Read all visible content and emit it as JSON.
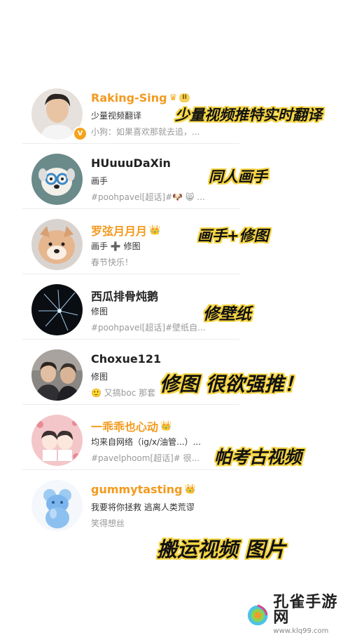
{
  "users": [
    {
      "name": "Raking-Sing",
      "name_style": "orange",
      "crown": "♛",
      "level": "II",
      "verified": "V",
      "line2": "少量视频翻译",
      "line3": "小狗：如果喜欢那就去追，..."
    },
    {
      "name": "HUuuuDaXin",
      "name_style": "dark",
      "crown": "",
      "level": "",
      "verified": "",
      "line2": "画手",
      "line3": "#poohpavel[超话]#🐶 😸 ..."
    },
    {
      "name": "罗弦月月月",
      "name_style": "orange",
      "crown": "👑",
      "level": "",
      "verified": "",
      "line2": "画手 ➕ 修图",
      "line3": "春节快乐！"
    },
    {
      "name": "西瓜排骨炖鹅",
      "name_style": "dark",
      "crown": "",
      "level": "",
      "verified": "",
      "line2": "修图",
      "line3": "#poohpavel[超话]#壁纸自..."
    },
    {
      "name": "Choxue121",
      "name_style": "dark",
      "crown": "",
      "level": "",
      "verified": "",
      "line2": "修图",
      "line3": "🙂 又搞boc 那套"
    },
    {
      "name": "一乖乖也心动",
      "name_style": "orange",
      "crown": "👑",
      "level": "",
      "verified": "",
      "line2": "均来自网络（ig/x/油管...）...",
      "line3": "#pavelphoom[超话]# 很..."
    },
    {
      "name": "gummytasting",
      "name_style": "orange",
      "crown": "👑",
      "level": "",
      "verified": "",
      "line2": "我要将你拯救 逃离人类荒谬",
      "line3": "笑得想丝"
    }
  ],
  "annotations": [
    "少量视频推特实时翻译",
    "同人画手",
    "画手+修图",
    "修壁纸",
    "修图 很欲强推！",
    "帕考古视频",
    "搬运视频 图片"
  ],
  "watermark": {
    "title": "孔雀手游网",
    "url": "www.klq99.com"
  }
}
